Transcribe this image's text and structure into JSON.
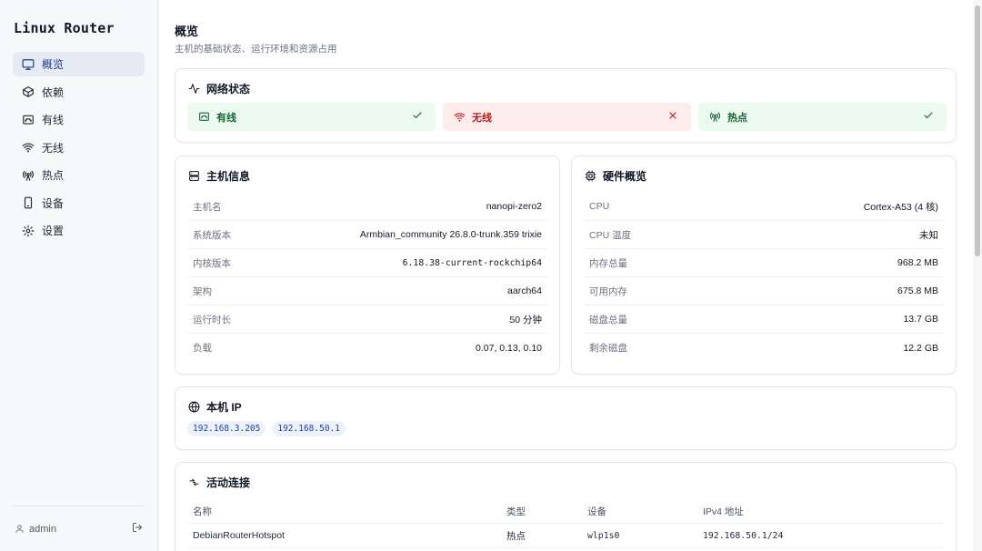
{
  "app": {
    "brand": "Linux Router"
  },
  "sidebar": {
    "items": [
      {
        "label": "概览",
        "icon": "monitor-icon",
        "active": true
      },
      {
        "label": "依赖",
        "icon": "package-icon",
        "active": false
      },
      {
        "label": "有线",
        "icon": "ethernet-icon",
        "active": false
      },
      {
        "label": "无线",
        "icon": "wifi-icon",
        "active": false
      },
      {
        "label": "热点",
        "icon": "hotspot-icon",
        "active": false
      },
      {
        "label": "设备",
        "icon": "device-icon",
        "active": false
      },
      {
        "label": "设置",
        "icon": "gear-icon",
        "active": false
      }
    ],
    "user": "admin"
  },
  "page": {
    "title": "概览",
    "subtitle": "主机的基础状态、运行环境和资源占用"
  },
  "network": {
    "title": "网络状态",
    "items": [
      {
        "label": "有线",
        "status": "ok"
      },
      {
        "label": "无线",
        "status": "error"
      },
      {
        "label": "热点",
        "status": "ok"
      }
    ]
  },
  "host": {
    "title": "主机信息",
    "rows": [
      {
        "k": "主机名",
        "v": "nanopi-zero2"
      },
      {
        "k": "系统版本",
        "v": "Armbian_community 26.8.0-trunk.359 trixie"
      },
      {
        "k": "内核版本",
        "v": "6.18.38-current-rockchip64"
      },
      {
        "k": "架构",
        "v": "aarch64"
      },
      {
        "k": "运行时长",
        "v": "50 分钟"
      },
      {
        "k": "负载",
        "v": "0.07, 0.13, 0.10"
      }
    ]
  },
  "hardware": {
    "title": "硬件概览",
    "rows": [
      {
        "k": "CPU",
        "v": "Cortex-A53 (4 核)"
      },
      {
        "k": "CPU 温度",
        "v": "未知"
      },
      {
        "k": "内存总量",
        "v": "968.2 MB"
      },
      {
        "k": "可用内存",
        "v": "675.8 MB"
      },
      {
        "k": "磁盘总量",
        "v": "13.7 GB"
      },
      {
        "k": "剩余磁盘",
        "v": "12.2 GB"
      }
    ]
  },
  "ip": {
    "title": "本机 IP",
    "addresses": [
      "192.168.3.205",
      "192.168.50.1"
    ]
  },
  "connections": {
    "title": "活动连接",
    "headers": [
      "名称",
      "类型",
      "设备",
      "IPv4 地址"
    ],
    "rows": [
      [
        "DebianRouterHotspot",
        "热点",
        "wlp1s0",
        "192.168.50.1/24"
      ]
    ]
  },
  "colors": {
    "ok": "#166534",
    "error": "#b91c1c",
    "accent": "#1e3a8a"
  }
}
